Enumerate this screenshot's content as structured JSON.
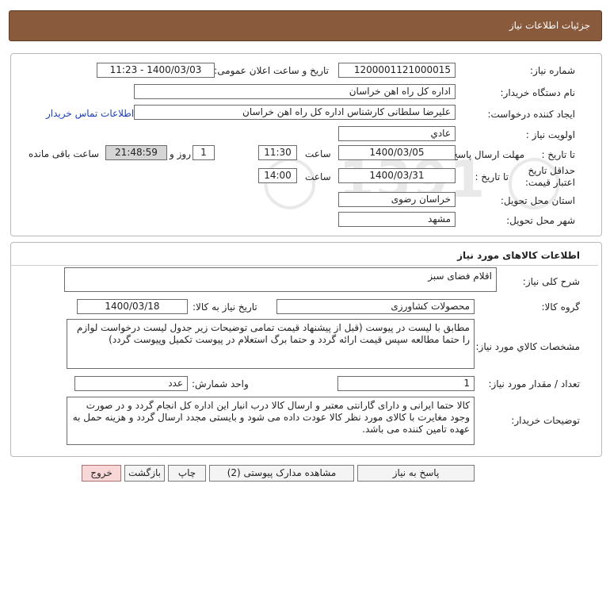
{
  "header": {
    "title": "جزئیات اطلاعات نیاز"
  },
  "general": {
    "need_number_label": "شماره نیاز:",
    "need_number": "1200001121000015",
    "announce_label": "تاریخ و ساعت اعلان عمومی:",
    "announce_value": "1400/03/03 - 11:23",
    "buyer_org_label": "نام دستگاه خریدار:",
    "buyer_org": "اداره کل راه اهن خراسان",
    "creator_label": "ایجاد کننده درخواست:",
    "creator": "علیرضا  سلطانی  کارشناس اداره کل راه اهن خراسان",
    "contact_link": "اطلاعات تماس خریدار",
    "priority_label": "اولویت نیاز :",
    "priority": "عادي",
    "deadline_label": "مهلت ارسال پاسخ:",
    "to_date_label": "تا تاریخ :",
    "deadline_date": "1400/03/05",
    "hour_label": "ساعت",
    "deadline_time": "11:30",
    "days_value": "1",
    "days_label": "روز و",
    "remaining_time": "21:48:59",
    "remaining_label": "ساعت باقی مانده",
    "validity_label": "حداقل تاریخ اعتبار قیمت:",
    "validity_to_label": "تا تاریخ :",
    "validity_date": "1400/03/31",
    "validity_hour_label": "ساعت",
    "validity_time": "14:00",
    "province_label": "استان محل تحویل:",
    "province": "خراسان رضوی",
    "city_label": "شهر محل تحویل:",
    "city": "مشهد"
  },
  "goods": {
    "section_title": "اطلاعات کالاهای مورد نیاز",
    "desc_label": "شرح کلی نیاز:",
    "desc": "اقلام فضای سبز",
    "group_label": "گروه کالا:",
    "group": "محصولات کشاورزی",
    "need_date_label": "تاریخ نیاز به کالا:",
    "need_date": "1400/03/18",
    "spec_label": "مشخصات کالاي مورد نياز:",
    "spec": "مطابق با لیست در پیوست (قبل از پیشنهاد قیمت تمامی توضیحات زیر جدول لیست درخواست لوازم را حتما مطالعه سپس قیمت ارائه گردد و حتما برگ استعلام در پیوست تکمیل وپیوست گردد)",
    "qty_label": "تعداد / مقدار مورد نیاز:",
    "qty": "1",
    "unit_label": "واحد شمارش:",
    "unit": "عدد",
    "buyer_notes_label": "توضیحات خریدار:",
    "buyer_notes": "کالا حتما ایرانی و دارای گارانتی معتبر و ارسال کالا درب انبار این اداره کل انجام گردد و در صورت وجود مغایرت با کالای مورد نظر کالا عودت داده می شود و بایستی مجدد ارسال گردد و هزینه حمل به عهده تامین کننده می باشد."
  },
  "actions": {
    "reply": "پاسخ به نیاز",
    "attachments": "مشاهده مدارک پیوستی (2)",
    "print": "چاپ",
    "back": "بازگشت",
    "exit": "خروج"
  }
}
